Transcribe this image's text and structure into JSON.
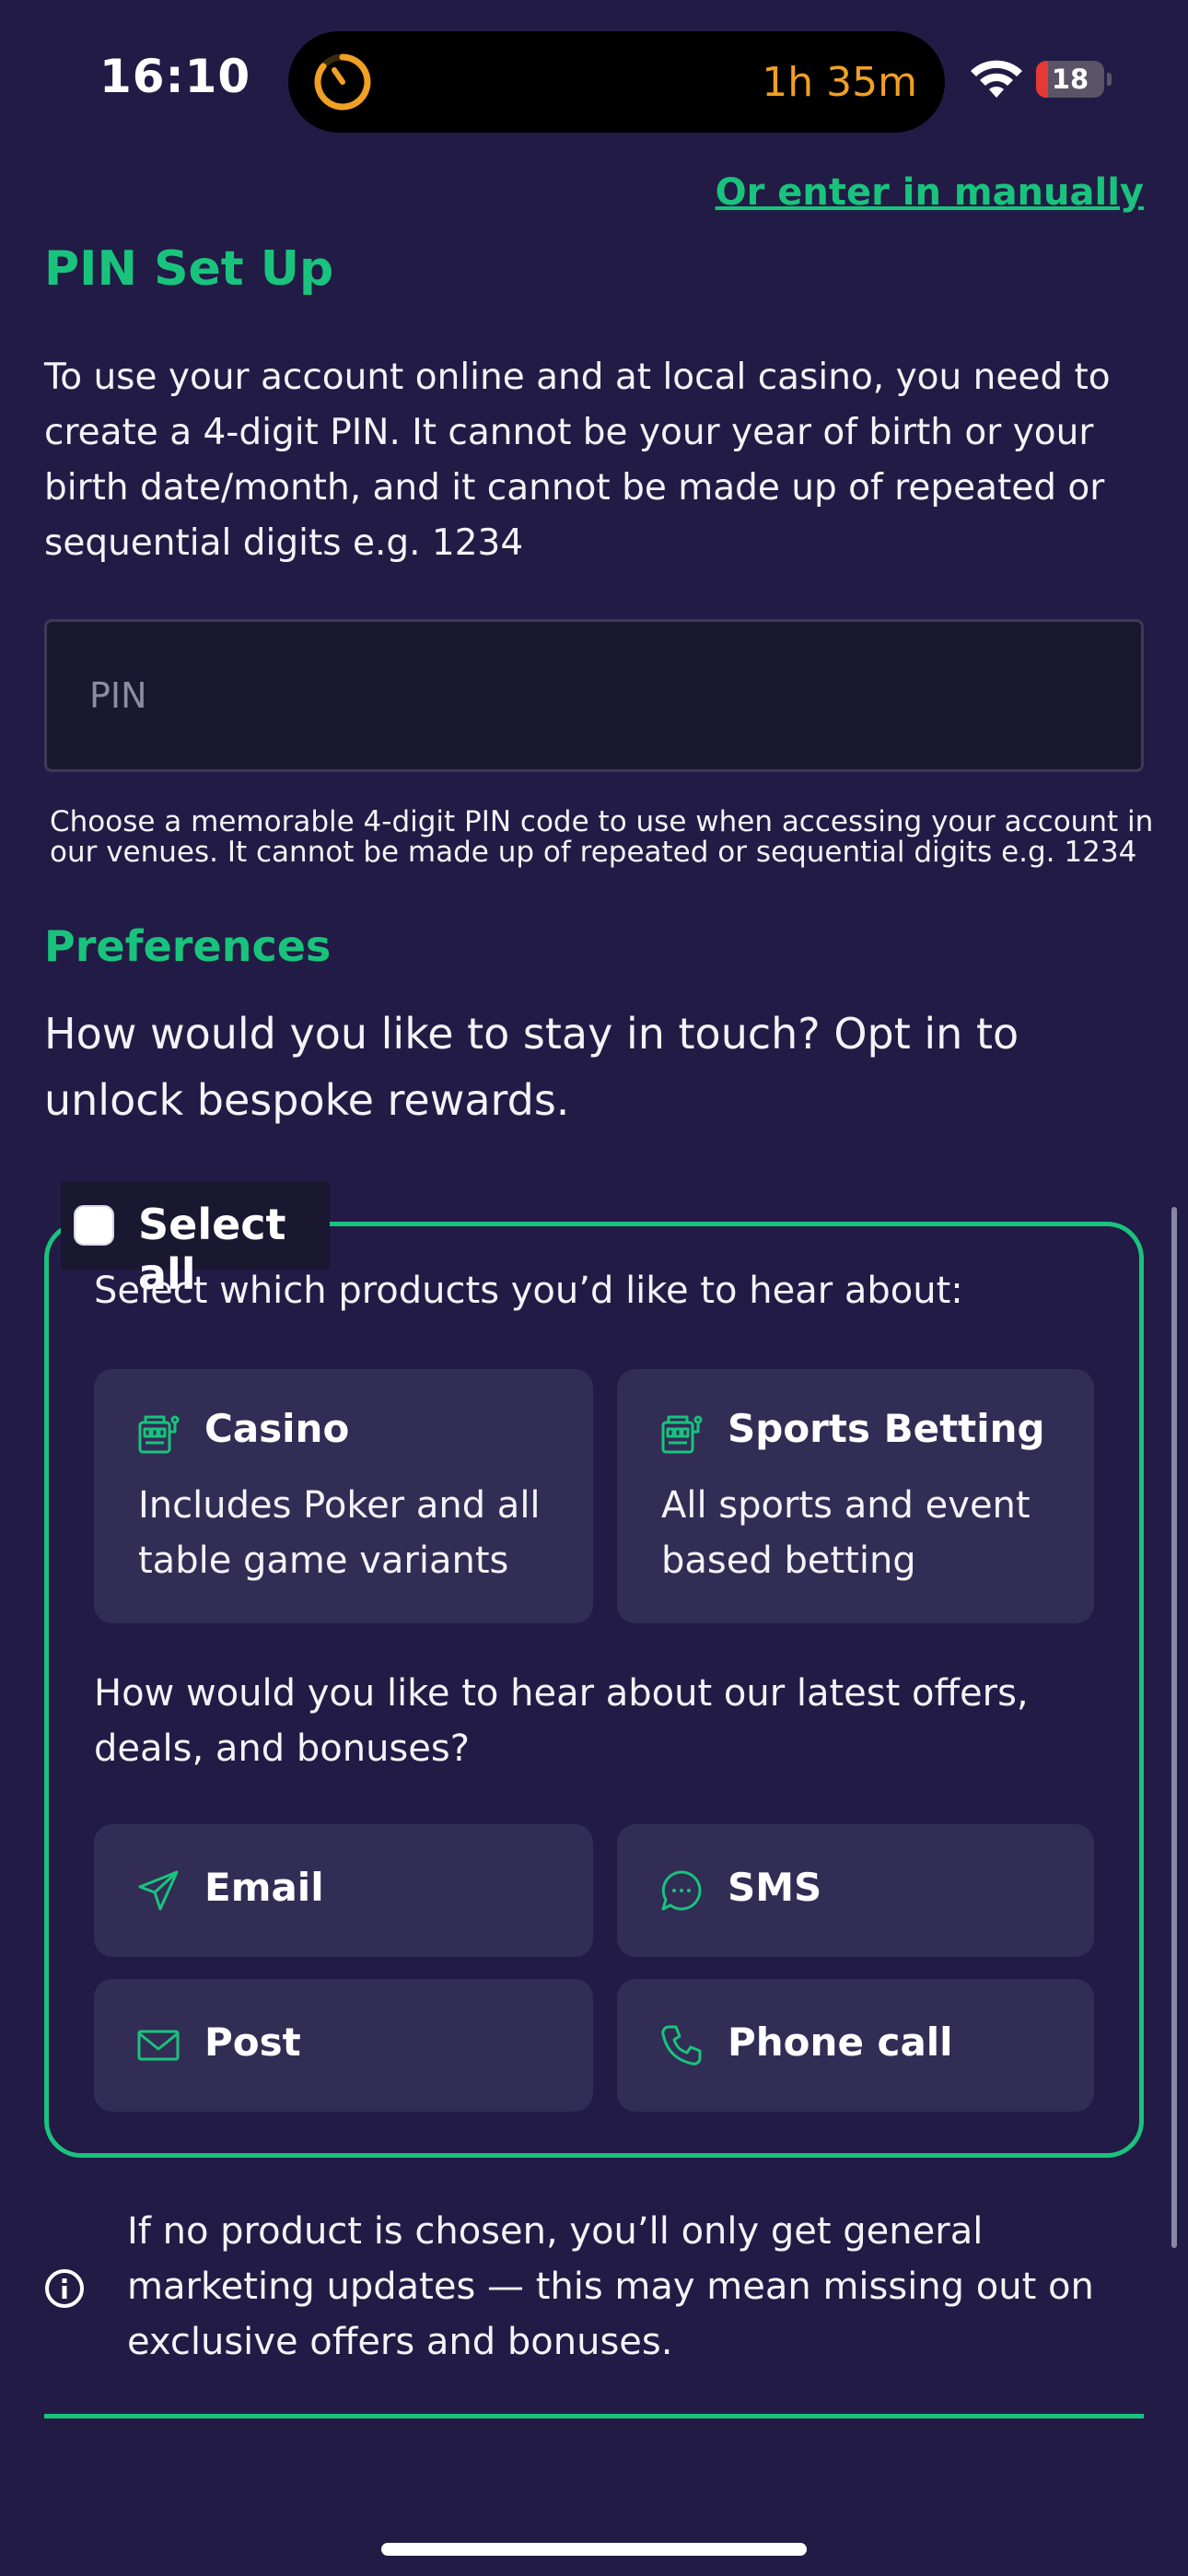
{
  "status_bar": {
    "time": "16:10",
    "timer": "1h 35m",
    "battery_level": "18",
    "battery_fraction": 0.18,
    "accent_timer_color": "#f0a024"
  },
  "manual_link": "Or enter in manually",
  "pin": {
    "title": "PIN Set Up",
    "description": "To use your account online and at local casino, you need to create a 4-digit PIN. It cannot be your year of birth or your birth date/month, and it cannot be made up of repeated or sequential digits e.g. 1234",
    "placeholder": "PIN",
    "hint": "Choose a memorable 4-digit PIN code to use when accessing your account in our venues. It cannot be made up of repeated or sequential digits e.g. 1234"
  },
  "preferences": {
    "title": "Preferences",
    "description": "How would you like to stay in touch? Opt in to unlock bespoke rewards.",
    "select_all": "Select all",
    "products_question": "Select which products you’d like to hear about:",
    "products": [
      {
        "icon": "slot-machine-icon",
        "title": "Casino",
        "desc": "Includes Poker and all table game variants"
      },
      {
        "icon": "slot-machine-icon",
        "title": "Sports Betting",
        "desc": "All sports and event based betting"
      }
    ],
    "offers_question": "How would you like to hear about our latest offers, deals, and bonuses?",
    "channels": [
      {
        "icon": "send-icon",
        "label": "Email"
      },
      {
        "icon": "chat-bubble-icon",
        "label": "SMS"
      },
      {
        "icon": "envelope-icon",
        "label": "Post"
      },
      {
        "icon": "phone-icon",
        "label": "Phone call"
      }
    ]
  },
  "info": {
    "icon": "info-icon",
    "text": "If no product is chosen, you’ll only get general marketing updates — this may mean missing out on exclusive offers and bonuses."
  },
  "colors": {
    "background": "#221b45",
    "accent": "#19c37d",
    "card": "#322d55"
  }
}
